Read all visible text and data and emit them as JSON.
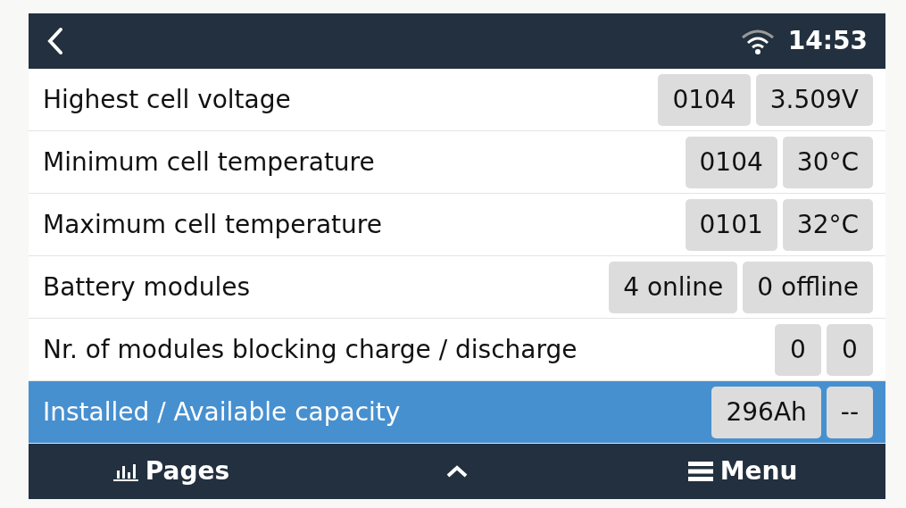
{
  "header": {
    "time": "14:53"
  },
  "rows": [
    {
      "label": "Highest cell voltage",
      "selected": false,
      "values": [
        "0104",
        "3.509V"
      ]
    },
    {
      "label": "Minimum cell temperature",
      "selected": false,
      "values": [
        "0104",
        "30°C"
      ]
    },
    {
      "label": "Maximum cell temperature",
      "selected": false,
      "values": [
        "0101",
        "32°C"
      ]
    },
    {
      "label": "Battery modules",
      "selected": false,
      "values": [
        "4 online",
        "0 offline"
      ]
    },
    {
      "label": "Nr. of modules blocking charge / discharge",
      "selected": false,
      "values": [
        "0",
        "0"
      ]
    },
    {
      "label": "Installed / Available capacity",
      "selected": true,
      "values": [
        "296Ah",
        "--"
      ]
    }
  ],
  "footer": {
    "pages": "Pages",
    "menu": "Menu"
  }
}
